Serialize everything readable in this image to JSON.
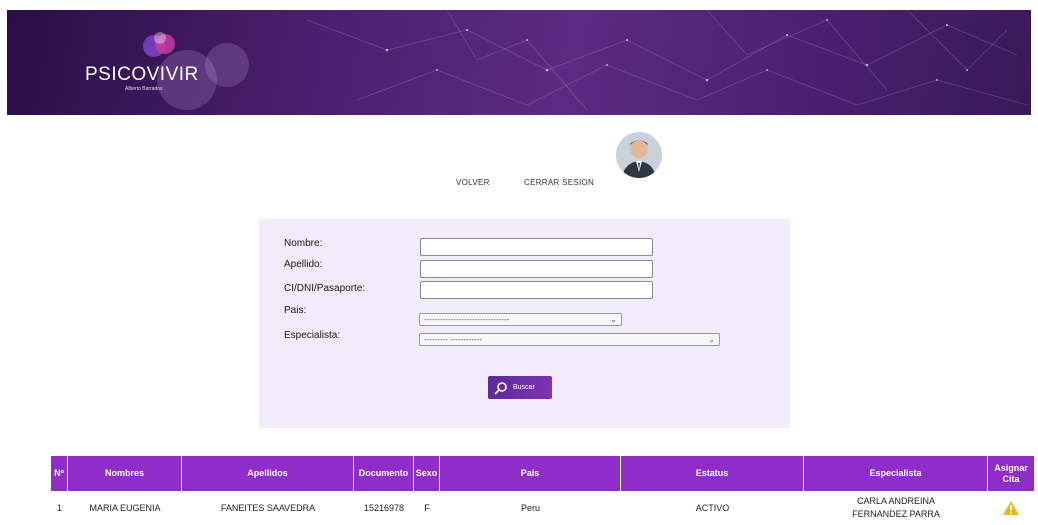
{
  "header": {
    "logo_text": "PSICOVIVIR",
    "logo_subtitle": "Alberto Barrados"
  },
  "nav": {
    "volver": "VOLVER",
    "cerrar_sesion": "CERRAR SESION"
  },
  "form": {
    "nombre_label": "Nombre:",
    "apellido_label": "Apellido:",
    "documento_label": "CI/DNI/Pasaporte:",
    "pais_label": "Pais:",
    "especialista_label": "Especialista:",
    "nombre_value": "",
    "apellido_value": "",
    "documento_value": "",
    "pais_selected": "--------------------------------",
    "especialista_selected": "--------- ------------",
    "search_button": "Buscar"
  },
  "table": {
    "columns": [
      "Nº",
      "Nombres",
      "Apellidos",
      "Documento",
      "Sexo",
      "Pais",
      "Estatus",
      "Especialista",
      "Asignar Cita"
    ],
    "rows": [
      {
        "n": "1",
        "nombres": "MARIA EUGENIA",
        "apellidos": "FANEITES SAAVEDRA",
        "documento": "15216978",
        "sexo": "F",
        "pais": "Peru",
        "estatus": "ACTIVO",
        "especialista": "CARLA ANDREINA FERNANDEZ PARRA",
        "accion_icon": "warning-icon"
      }
    ]
  },
  "colors": {
    "brand_purple": "#8e2dc8",
    "panel_bg": "#f1ebfa",
    "banner_dark": "#2a0f45",
    "warning": "#e8b81a"
  }
}
